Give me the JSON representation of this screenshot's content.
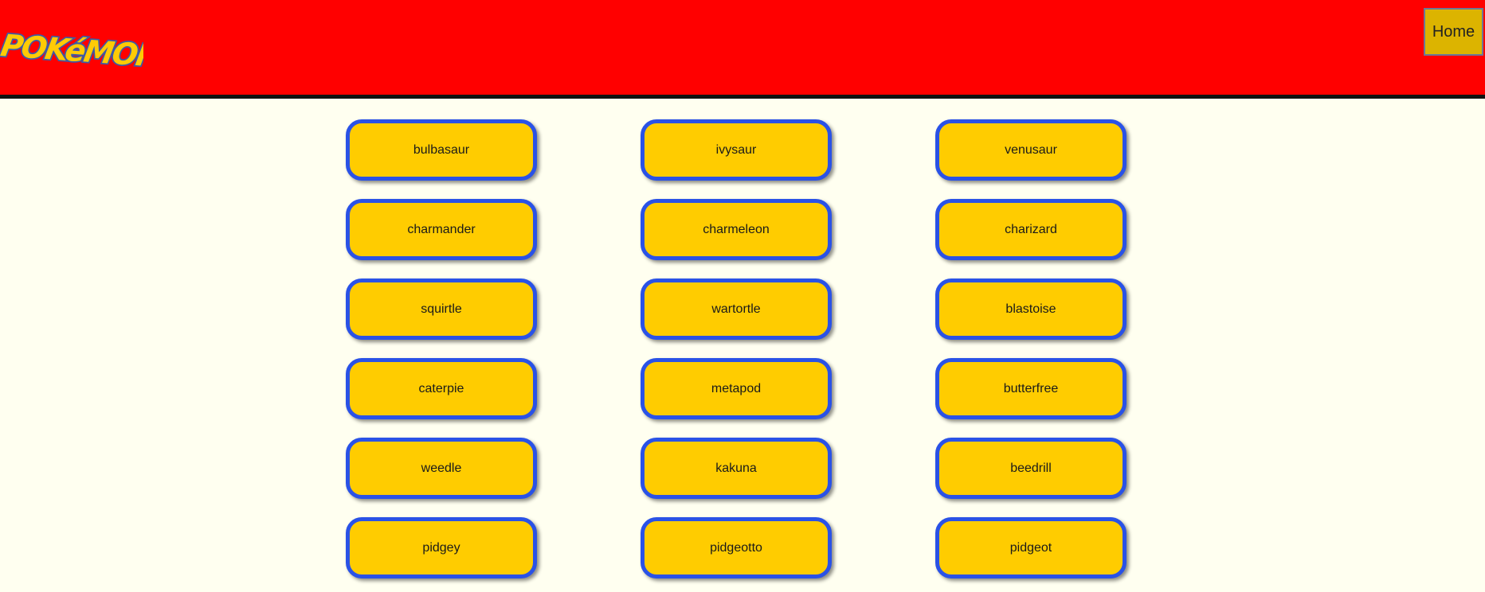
{
  "header": {
    "logo_text": "POKéMON",
    "home_label": "Home"
  },
  "colors": {
    "header_bg": "#ff0000",
    "page_bg": "#fffff0",
    "card_bg": "#ffcc00",
    "card_border": "#2a52e6",
    "home_bg": "#dcb400"
  },
  "pokemon": [
    "bulbasaur",
    "ivysaur",
    "venusaur",
    "charmander",
    "charmeleon",
    "charizard",
    "squirtle",
    "wartortle",
    "blastoise",
    "caterpie",
    "metapod",
    "butterfree",
    "weedle",
    "kakuna",
    "beedrill",
    "pidgey",
    "pidgeotto",
    "pidgeot"
  ]
}
